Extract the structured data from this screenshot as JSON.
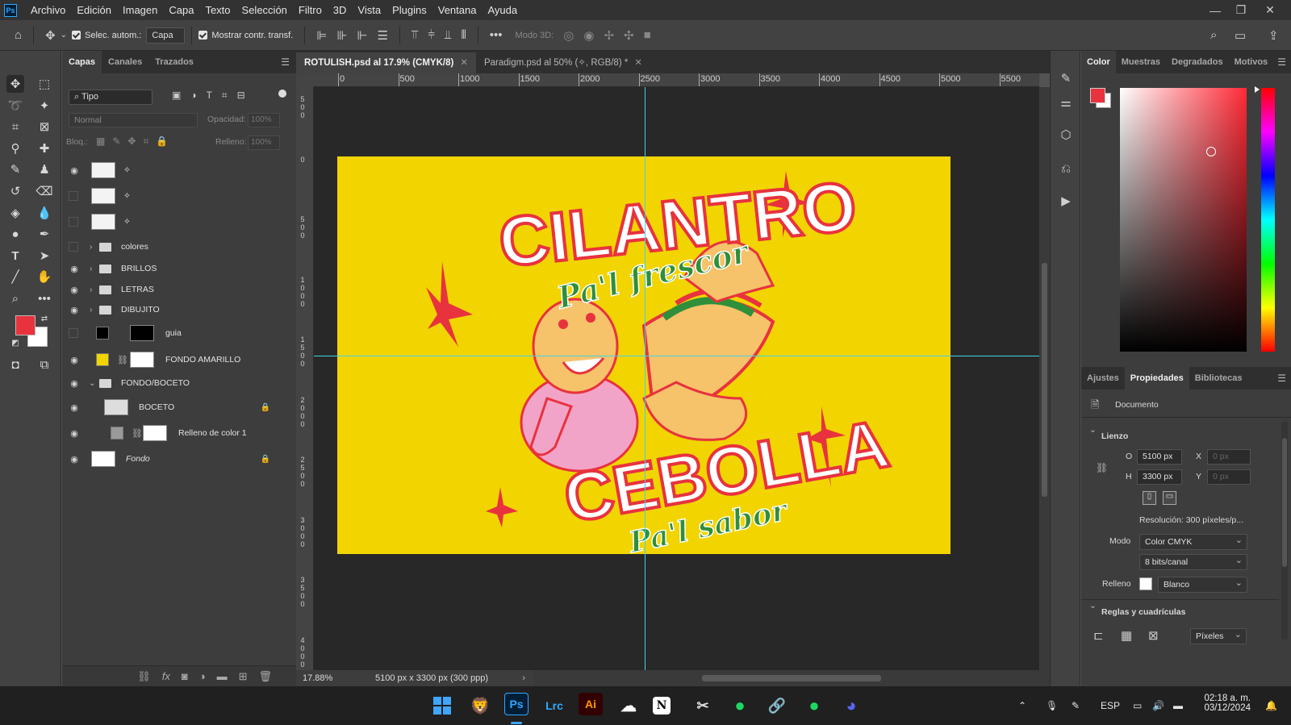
{
  "app": {
    "menu": [
      "Archivo",
      "Edición",
      "Imagen",
      "Capa",
      "Texto",
      "Selección",
      "Filtro",
      "3D",
      "Vista",
      "Plugins",
      "Ventana",
      "Ayuda"
    ],
    "logo": "Ps"
  },
  "options": {
    "auto_select": "Selec. autom.:",
    "target": "Capa",
    "show_transform": "Mostrar contr. transf.",
    "mode3d": "Modo 3D:"
  },
  "layers_panel": {
    "tabs": [
      "Capas",
      "Canales",
      "Trazados"
    ],
    "filter": "Tipo",
    "blend": "Normal",
    "opacity_label": "Opacidad:",
    "opacity": "100%",
    "lock_label": "Bloq.:",
    "fill_label": "Relleno:",
    "fill": "100%",
    "layers": [
      {
        "name": "✧",
        "kind": "layer",
        "visible": true
      },
      {
        "name": "✧",
        "kind": "layer",
        "visible": false
      },
      {
        "name": "✧",
        "kind": "layer",
        "visible": false
      },
      {
        "name": "colores",
        "kind": "group",
        "visible": false
      },
      {
        "name": "BRILLOS",
        "kind": "group",
        "visible": true
      },
      {
        "name": "LETRAS",
        "kind": "group",
        "visible": true
      },
      {
        "name": "DIBUJITO",
        "kind": "group",
        "visible": true
      },
      {
        "name": "guia",
        "kind": "fill",
        "visible": false
      },
      {
        "name": "FONDO AMARILLO",
        "kind": "fill",
        "visible": true
      },
      {
        "name": "FONDO/BOCETO",
        "kind": "group-open",
        "visible": true
      },
      {
        "name": "BOCETO",
        "kind": "layer",
        "visible": true
      },
      {
        "name": "Relleno de color 1",
        "kind": "fill",
        "visible": true
      },
      {
        "name": "Fondo",
        "kind": "background",
        "visible": true
      }
    ]
  },
  "documents": {
    "tabs": [
      {
        "label": "ROTULISH.psd al 17.9% (CMYK/8)",
        "active": true
      },
      {
        "label": "Paradigm.psd al 50% (✧, RGB/8) *",
        "active": false
      }
    ]
  },
  "ruler": {
    "h_labels": [
      "0",
      "500",
      "1000",
      "1500",
      "2000",
      "2500",
      "3000",
      "3500",
      "4000",
      "4500",
      "5000",
      "5500"
    ],
    "v_labels": [
      "500",
      "0",
      "500",
      "1000",
      "1500",
      "2000",
      "2500",
      "3000",
      "3500",
      "4000"
    ]
  },
  "artwork": {
    "top_word": "CILANTRO",
    "top_sub": "Pa'l frescor",
    "bottom_word": "CEBOLLA",
    "bottom_sub": "Pa'l sabor"
  },
  "status": {
    "zoom": "17.88%",
    "doc_size": "5100 px x 3300 px (300 ppp)"
  },
  "colors": {
    "foreground": "#e8323e",
    "background": "#ffffff",
    "canvas": "#f1d400",
    "guide": "#3fd5e6"
  },
  "right_panel": {
    "color_tabs": [
      "Color",
      "Muestras",
      "Degradados",
      "Motivos"
    ],
    "prop_tabs": [
      "Ajustes",
      "Propiedades",
      "Bibliotecas"
    ],
    "document_label": "Documento",
    "canvas_section": "Lienzo",
    "width_label": "O",
    "width": "5100 px",
    "height_label": "H",
    "height": "3300 px",
    "x_label": "X",
    "x": "0 px",
    "y_label": "Y",
    "y": "0 px",
    "resolution": "Resolución: 300 píxeles/p...",
    "mode_label": "Modo",
    "mode": "Color CMYK",
    "bits": "8 bits/canal",
    "fill_label": "Relleno",
    "fill": "Blanco",
    "rulers_section": "Reglas y cuadrículas",
    "units": "Píxeles"
  },
  "taskbar": {
    "apps": [
      "Lrc",
      "Ai"
    ],
    "lang": "ESP",
    "time": "02:18 a. m.",
    "date": "03/12/2024"
  }
}
